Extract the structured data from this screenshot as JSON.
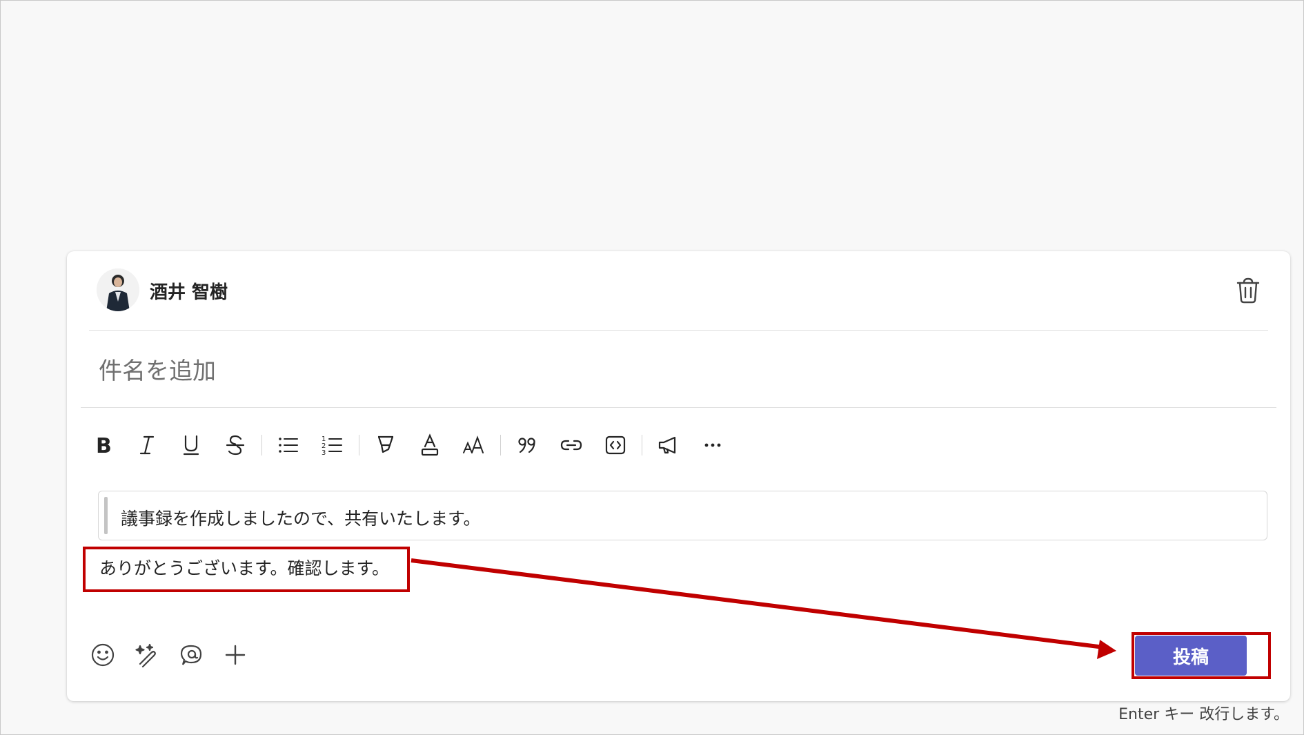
{
  "post": {
    "author_name": "酒井 智樹",
    "subject_placeholder": "件名を追加",
    "quoted_text": "議事録を作成しましたので、共有いたします。",
    "reply_text": "ありがとうございます。確認します。",
    "post_button_label": "投稿",
    "enter_hint": "Enter キー 改行します。"
  },
  "toolbar_icons": [
    "bold-icon",
    "italic-icon",
    "underline-icon",
    "strikethrough-icon",
    "bullet-list-icon",
    "numbered-list-icon",
    "highlight-icon",
    "font-color-icon",
    "font-size-icon",
    "quote-icon",
    "link-icon",
    "code-icon",
    "announcement-icon",
    "more-icon"
  ],
  "bottom_icons": [
    "emoji-icon",
    "copilot-icon",
    "loop-icon",
    "add-icon"
  ],
  "colors": {
    "accent": "#5b5fc7",
    "annotation": "#c00000",
    "text": "#242424",
    "placeholder": "#707070"
  }
}
